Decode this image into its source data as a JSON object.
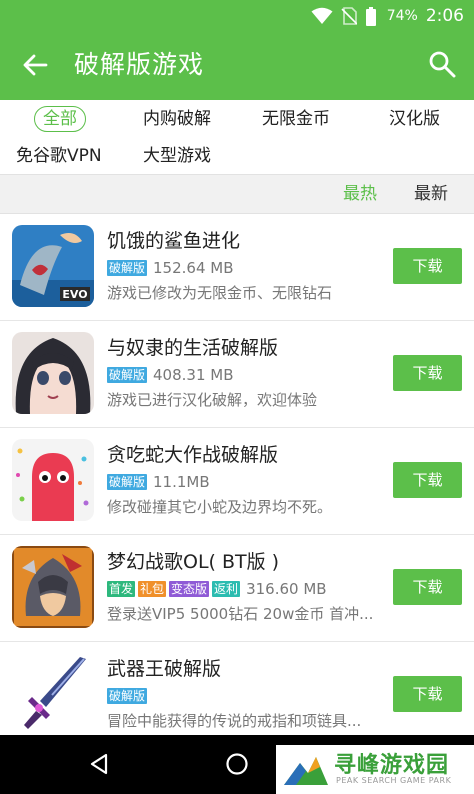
{
  "status_bar": {
    "battery_pct": "74%",
    "time": "2:06"
  },
  "app_bar": {
    "title": "破解版游戏"
  },
  "filters": [
    "全部",
    "内购破解",
    "无限金币",
    "汉化版",
    "免谷歌VPN",
    "大型游戏"
  ],
  "sort": {
    "hot": "最热",
    "newest": "最新"
  },
  "download_label": "下载",
  "games": [
    {
      "name": "饥饿的鲨鱼进化",
      "tags": [
        {
          "text": "破解版",
          "color": "#3fa9e0"
        }
      ],
      "size": "152.64 MB",
      "desc": "游戏已修改为无限金币、无限钻石",
      "thumb_label": "EVO"
    },
    {
      "name": "与奴隶的生活破解版",
      "tags": [
        {
          "text": "破解版",
          "color": "#3fa9e0"
        }
      ],
      "size": "408.31 MB",
      "desc": "游戏已进行汉化破解，欢迎体验"
    },
    {
      "name": "贪吃蛇大作战破解版",
      "tags": [
        {
          "text": "破解版",
          "color": "#3fa9e0"
        }
      ],
      "size": "11.1MB",
      "desc": "修改碰撞其它小蛇及边界均不死。"
    },
    {
      "name": "梦幻战歌OL( BT版 )",
      "tags": [
        {
          "text": "首发",
          "color": "#2db87d"
        },
        {
          "text": "礼包",
          "color": "#f0902a"
        },
        {
          "text": "变态版",
          "color": "#8f5bd6"
        },
        {
          "text": "返利",
          "color": "#2cbcb0"
        }
      ],
      "size": "316.60 MB",
      "desc": "登录送VIP5 5000钻石 20w金币 首冲..."
    },
    {
      "name": "武器王破解版",
      "tags": [
        {
          "text": "破解版",
          "color": "#3fa9e0"
        }
      ],
      "size": "",
      "desc": "冒险中能获得的传说的戒指和项链具..."
    }
  ],
  "watermark": {
    "title": "寻峰游戏园",
    "subtitle": "PEAK SEARCH GAME PARK"
  }
}
